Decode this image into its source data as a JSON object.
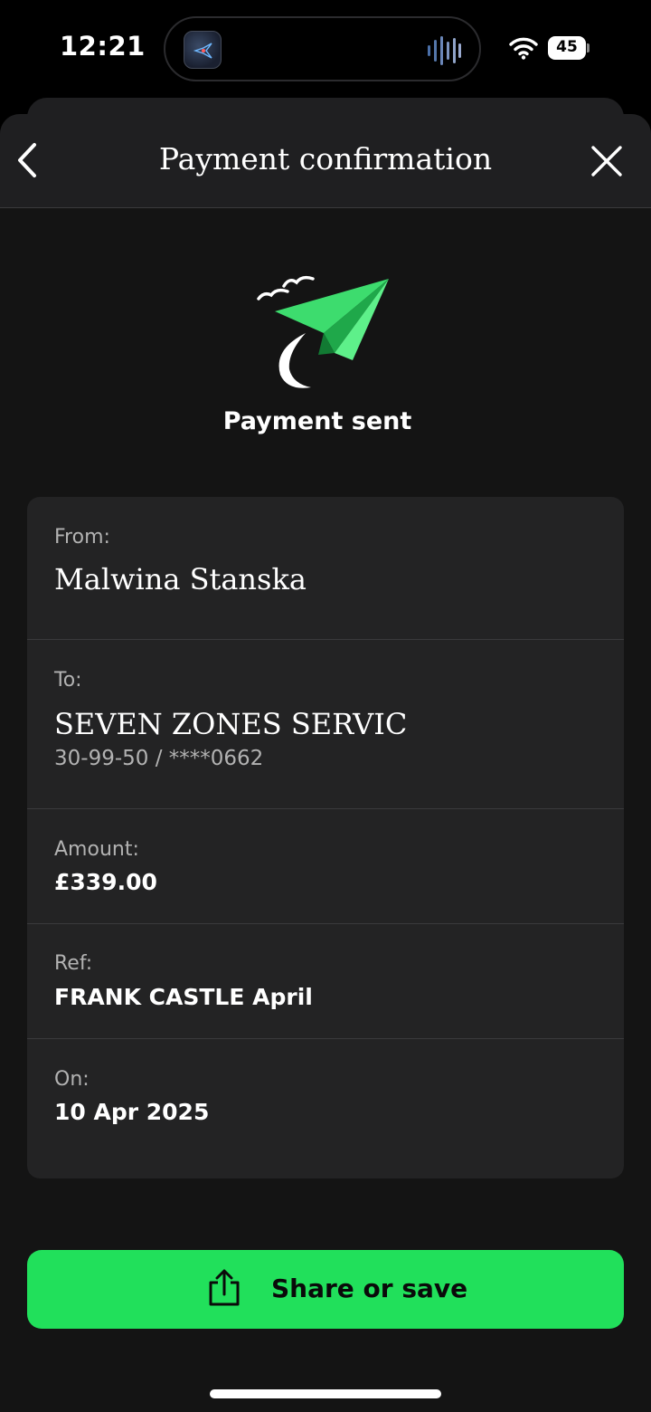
{
  "status_bar": {
    "time": "12:21",
    "battery": "45",
    "icons": [
      "app-icon",
      "audio-wave-icon",
      "wifi-icon",
      "battery-icon"
    ]
  },
  "nav": {
    "title": "Payment confirmation",
    "back_icon": "chevron-left-icon",
    "close_icon": "close-icon"
  },
  "hero": {
    "illustration": "paper-plane-icon",
    "title": "Payment sent"
  },
  "details": {
    "from_label": "From:",
    "from_value": "Malwina Stanska",
    "to_label": "To:",
    "to_value": "SEVEN ZONES SERVIC",
    "to_account": "30-99-50 / ****0662",
    "amount_label": "Amount:",
    "amount_value": "£339.00",
    "ref_label": "Ref:",
    "ref_value": "FRANK CASTLE April",
    "on_label": "On:",
    "on_value": "10 Apr 2025"
  },
  "actions": {
    "share_label": "Share or save",
    "share_icon": "share-icon"
  },
  "colors": {
    "accent": "#21e05b",
    "plane": "#3ddc6e",
    "card": "#232324",
    "background": "#141414"
  }
}
